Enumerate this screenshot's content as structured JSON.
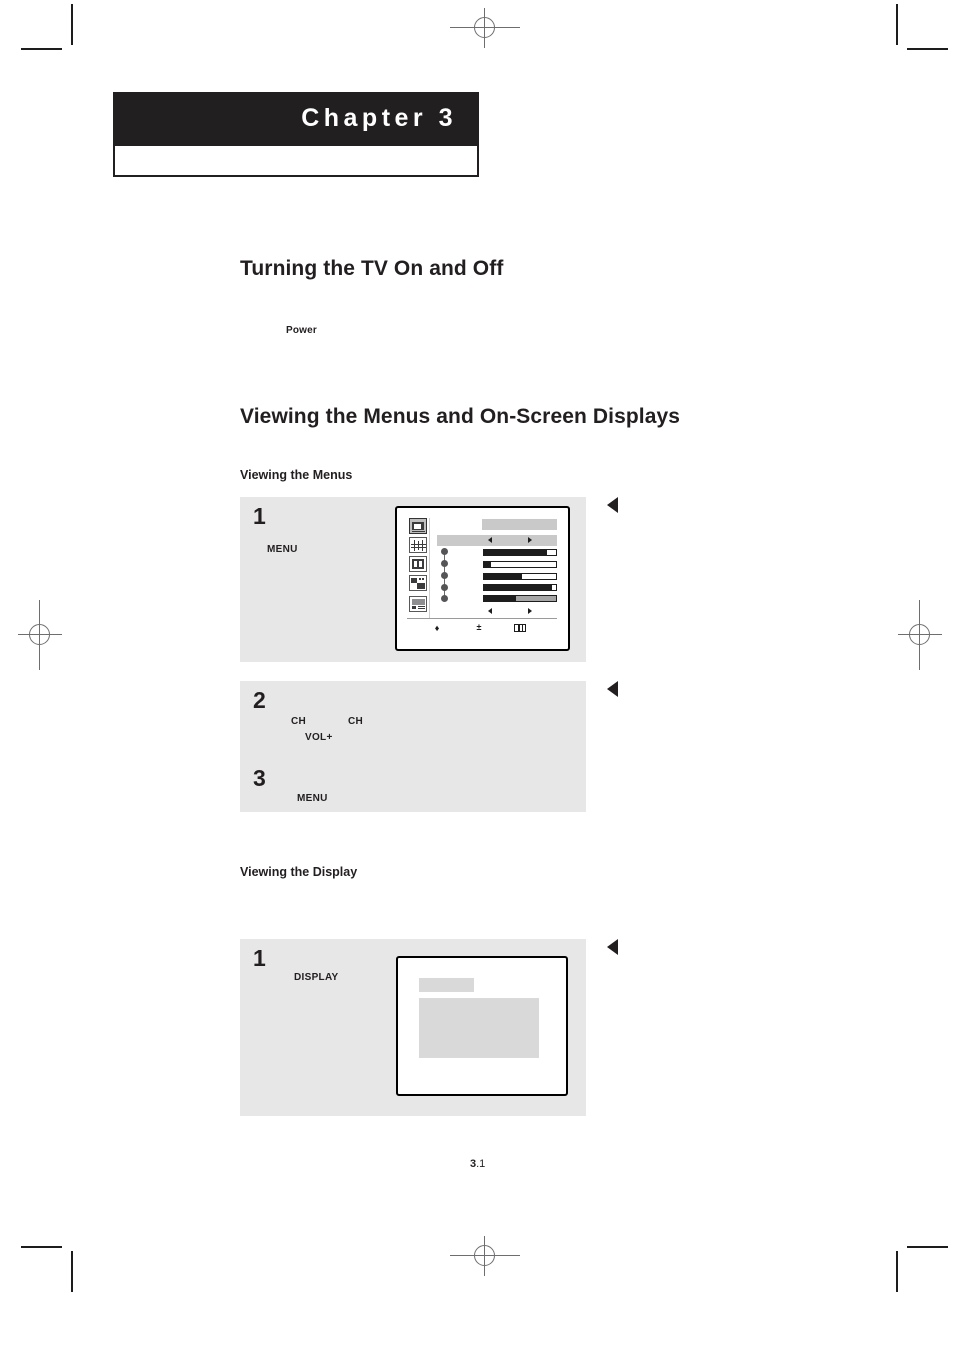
{
  "chapter": {
    "banner_title": "Chapter 3"
  },
  "sections": {
    "power": {
      "heading": "Turning the TV On and Off",
      "key_label": "Power"
    },
    "menus": {
      "heading": "Viewing the Menus and On-Screen Displays",
      "subheading": "Viewing the Menus",
      "steps": [
        {
          "number": "1",
          "key": "MENU"
        },
        {
          "number": "2",
          "key_a": "CH",
          "key_b": "CH",
          "key_c": "VOL+"
        },
        {
          "number": "3",
          "key": "MENU"
        }
      ]
    },
    "display": {
      "subheading": "Viewing the Display",
      "steps": [
        {
          "number": "1",
          "key": "DISPLAY"
        }
      ]
    }
  },
  "osd_menu": {
    "sidebar_icons": [
      "picture-menu-icon",
      "sound-menu-icon",
      "channel-menu-icon",
      "setup-menu-icon",
      "pip-menu-icon"
    ],
    "selected_index": 0,
    "sliders": [
      {
        "name": "contrast-slider",
        "fill_pct": 88,
        "secondary_pct": 0
      },
      {
        "name": "brightness-slider",
        "fill_pct": 10,
        "secondary_pct": 0
      },
      {
        "name": "sharpness-slider",
        "fill_pct": 53,
        "secondary_pct": 0
      },
      {
        "name": "color-slider",
        "fill_pct": 95,
        "secondary_pct": 0
      },
      {
        "name": "tint-slider",
        "fill_pct": 45,
        "secondary_pct": 55
      }
    ],
    "footer_icons": [
      "move-updown-icon",
      "adjust-plusminus-icon",
      "exit-menu-icon"
    ]
  },
  "osd_display": {
    "top_bar_label": "channel-banner",
    "body_block_label": "info-block"
  },
  "footer": {
    "page_prefix": "3",
    "page_suffix": ".1"
  },
  "colors": {
    "banner_bg": "#221f20",
    "panel_bg": "#e7e7e7",
    "osd_grey": "#c9c9c9",
    "ink": "#231f20"
  }
}
